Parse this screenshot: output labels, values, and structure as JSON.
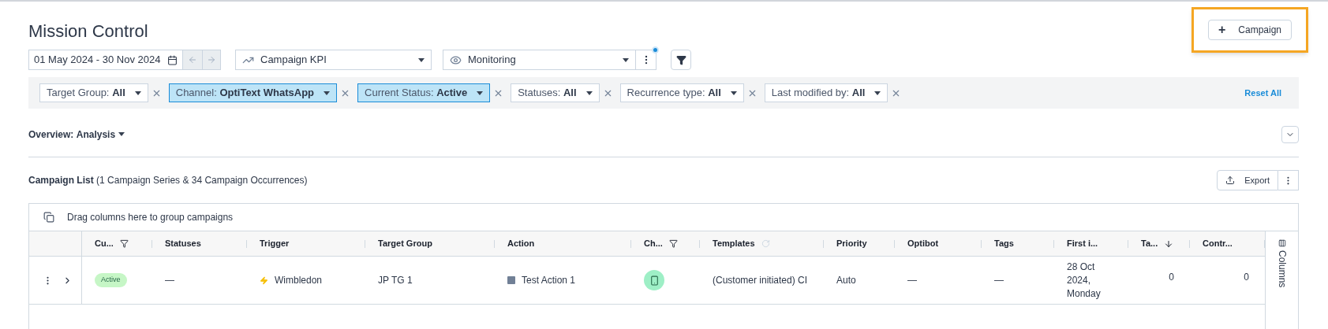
{
  "page_title": "Mission Control",
  "new_campaign_button": {
    "icon": "+",
    "label": "Campaign",
    "highlighted": true
  },
  "toolbar": {
    "date_range": "01 May 2024 - 30 Nov 2024",
    "kpi_select": "Campaign KPI",
    "view_select": "Monitoring",
    "view_menu_notification": true
  },
  "filters": [
    {
      "label": "Target Group:",
      "value": "All",
      "active": false
    },
    {
      "label": "Channel:",
      "value": "OptiText WhatsApp",
      "active": true
    },
    {
      "label": "Current Status:",
      "value": "Active",
      "active": true
    },
    {
      "label": "Statuses:",
      "value": "All",
      "active": false
    },
    {
      "label": "Recurrence type:",
      "value": "All",
      "active": false
    },
    {
      "label": "Last modified by:",
      "value": "All",
      "active": false
    }
  ],
  "reset_all": "Reset All",
  "overview": {
    "label": "Overview:",
    "value": "Analysis"
  },
  "campaign_list": {
    "title": "Campaign List",
    "summary": "(1 Campaign Series & 34 Campaign Occurrences)",
    "export": "Export"
  },
  "group_hint": "Drag columns here to group campaigns",
  "table": {
    "columns": [
      {
        "label": "Cu...",
        "kind": "filter"
      },
      {
        "label": "Statuses",
        "kind": "plain"
      },
      {
        "label": "Trigger",
        "kind": "plain"
      },
      {
        "label": "Target Group",
        "kind": "plain"
      },
      {
        "label": "Action",
        "kind": "plain"
      },
      {
        "label": "Ch...",
        "kind": "filter"
      },
      {
        "label": "Templates",
        "kind": "refresh"
      },
      {
        "label": "Priority",
        "kind": "plain"
      },
      {
        "label": "Optibot",
        "kind": "plain"
      },
      {
        "label": "Tags",
        "kind": "plain"
      },
      {
        "label": "First i...",
        "kind": "plain"
      },
      {
        "label": "Ta...",
        "kind": "sort"
      },
      {
        "label": "Contr...",
        "kind": "plain"
      }
    ],
    "rows": [
      {
        "cells": [
          {
            "kind": "badge",
            "text": "Active"
          },
          {
            "kind": "text",
            "text": "—"
          },
          {
            "kind": "trigger",
            "text": "Wimbledon"
          },
          {
            "kind": "text",
            "text": "JP TG 1"
          },
          {
            "kind": "action",
            "text": "Test Action 1"
          },
          {
            "kind": "channel"
          },
          {
            "kind": "text",
            "text": "(Customer initiated) CI"
          },
          {
            "kind": "text",
            "text": "Auto"
          },
          {
            "kind": "text",
            "text": "—"
          },
          {
            "kind": "text",
            "text": "—"
          },
          {
            "kind": "date",
            "lines": [
              "28 Oct",
              "2024,",
              "Monday"
            ]
          },
          {
            "kind": "number",
            "text": "0"
          },
          {
            "kind": "number",
            "text": "0"
          }
        ]
      }
    ]
  },
  "columns_panel": "Columns"
}
